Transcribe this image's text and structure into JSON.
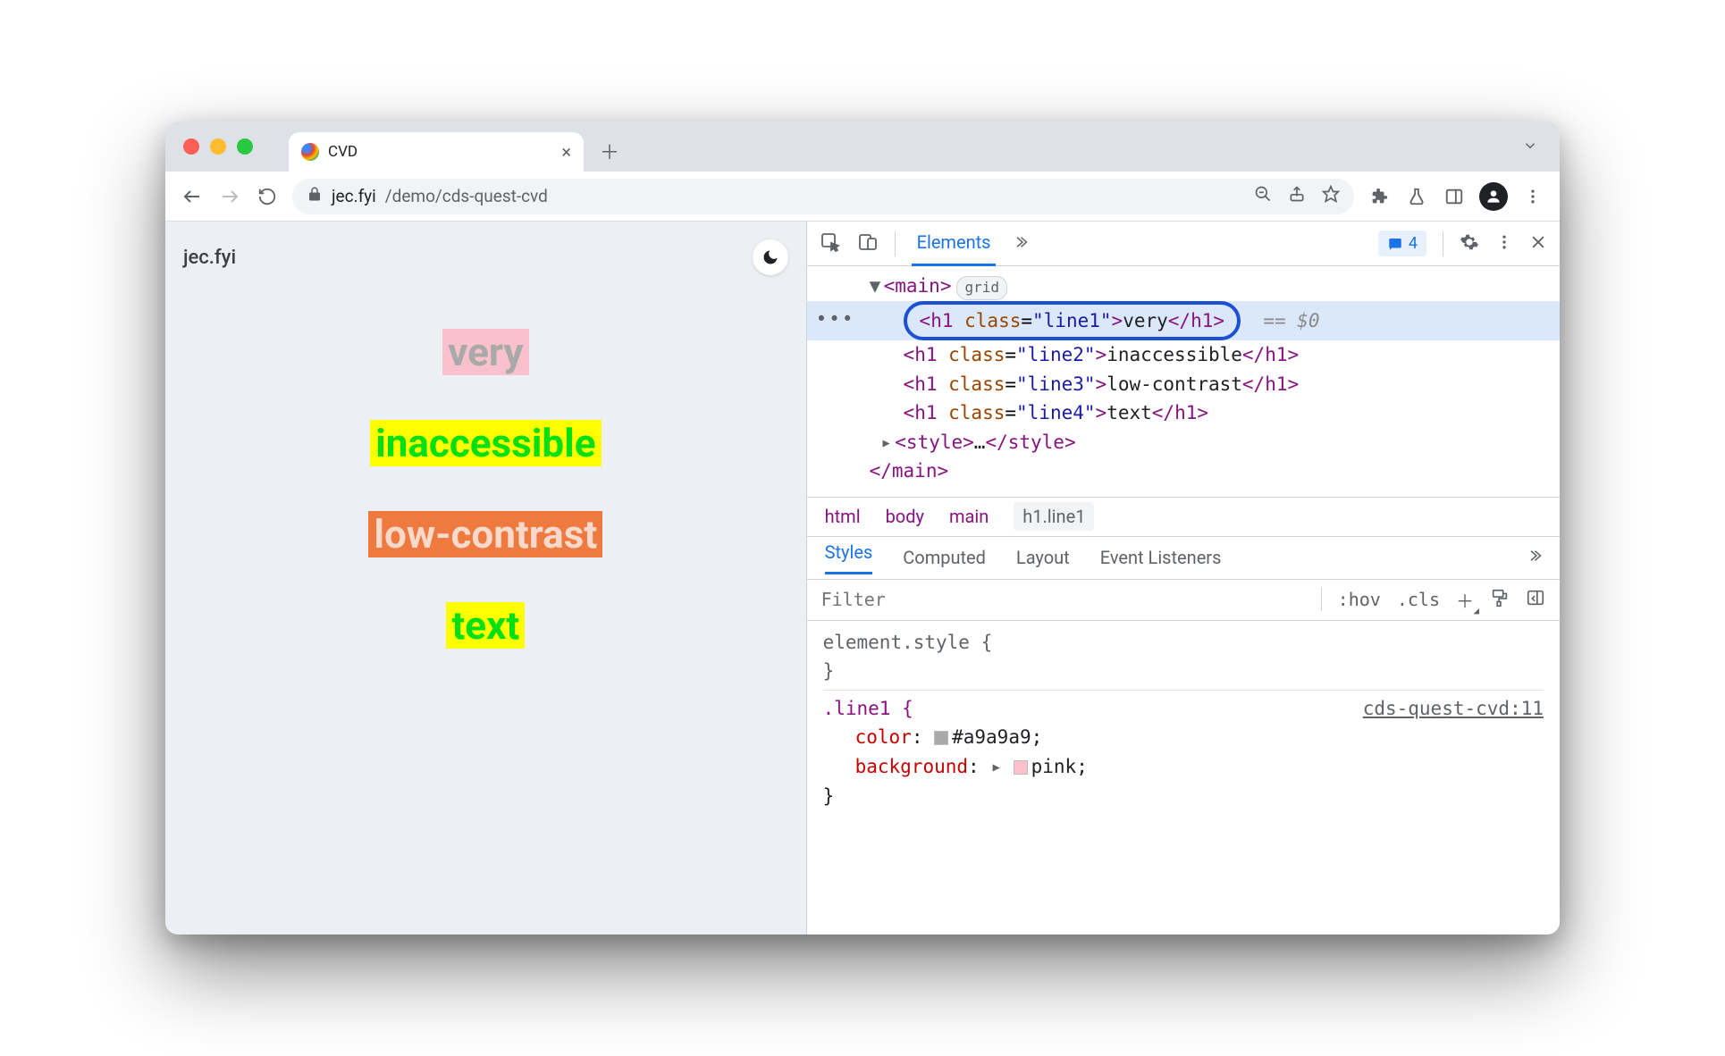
{
  "browser": {
    "tab_title": "CVD",
    "url_host": "jec.fyi",
    "url_path": "/demo/cds-quest-cvd"
  },
  "page": {
    "site_name": "jec.fyi",
    "lines": {
      "l1": "very",
      "l2": "inaccessible",
      "l3": "low-contrast",
      "l4": "text"
    }
  },
  "devtools": {
    "tabs": {
      "elements": "Elements"
    },
    "issues_count": "4",
    "dom": {
      "main_open": "main",
      "grid_pill": "grid",
      "h1_tag": "h1",
      "class_attr": "class",
      "line1_val": "\"line1\"",
      "line1_text": "very",
      "ref": "== $0",
      "line2_val": "\"line2\"",
      "line2_text": "inaccessible",
      "line3_val": "\"line3\"",
      "line3_text": "low-contrast",
      "line4_val": "\"line4\"",
      "line4_text": "text",
      "style_tag": "style",
      "ellipsis": "…",
      "main_close": "main"
    },
    "crumbs": {
      "c1": "html",
      "c2": "body",
      "c3": "main",
      "c4": "h1.line1"
    },
    "sp_tabs": {
      "styles": "Styles",
      "computed": "Computed",
      "layout": "Layout",
      "listeners": "Event Listeners"
    },
    "filter": {
      "placeholder": "Filter",
      "hov": ":hov",
      "cls": ".cls"
    },
    "styles": {
      "element_style": "element.style {",
      "close_brace": "}",
      "rule_head_sel": ".line1 {",
      "rule_src": "cds-quest-cvd:11",
      "color_prop": "color",
      "color_val": "#a9a9a9",
      "bg_prop": "background",
      "bg_val": "pink",
      "color_swatch": "#a9a9a9",
      "bg_swatch": "#ffc0cb"
    }
  }
}
